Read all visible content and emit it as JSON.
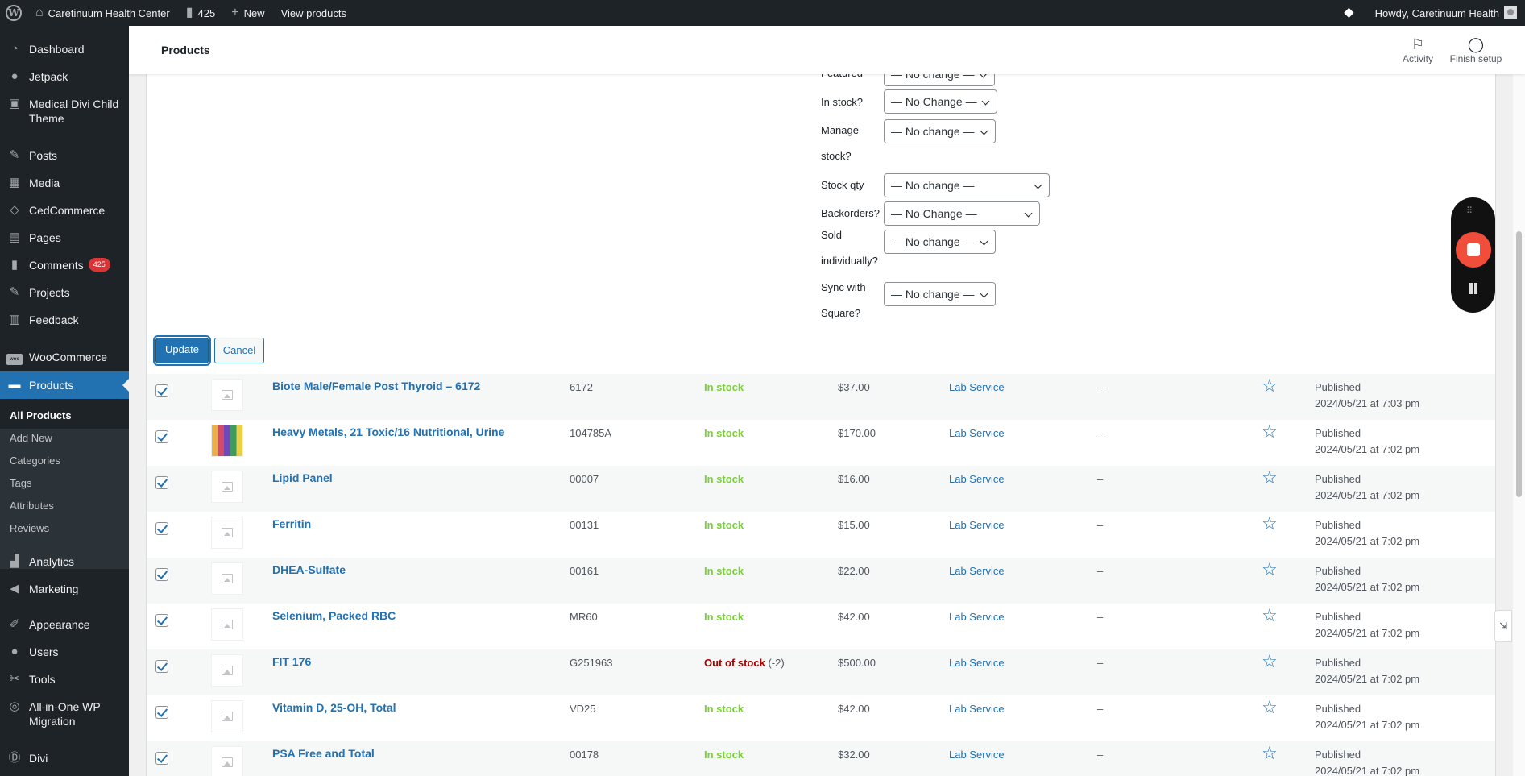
{
  "adminbar": {
    "site_name": "Caretinuum Health Center",
    "comments_count": "425",
    "new_label": "New",
    "view_products": "View products",
    "howdy": "Howdy, Caretinuum Health"
  },
  "sidebar": {
    "items": [
      {
        "label": "Dashboard"
      },
      {
        "label": "Jetpack"
      },
      {
        "label": "Medical Divi Child Theme"
      },
      {
        "label": "Posts"
      },
      {
        "label": "Media"
      },
      {
        "label": "CedCommerce"
      },
      {
        "label": "Pages"
      },
      {
        "label": "Comments",
        "badge": "425"
      },
      {
        "label": "Projects"
      },
      {
        "label": "Feedback"
      },
      {
        "label": "WooCommerce",
        "icon_text": "woo"
      },
      {
        "label": "Products"
      },
      {
        "label": "Analytics"
      },
      {
        "label": "Marketing"
      },
      {
        "label": "Appearance"
      },
      {
        "label": "Users"
      },
      {
        "label": "Tools"
      },
      {
        "label": "All-in-One WP Migration"
      },
      {
        "label": "Divi"
      }
    ],
    "submenu": [
      "All Products",
      "Add New",
      "Categories",
      "Tags",
      "Attributes",
      "Reviews"
    ]
  },
  "header": {
    "title": "Products",
    "activity": "Activity",
    "finish_setup": "Finish setup"
  },
  "bulk_edit": {
    "fields": [
      {
        "label": "Featured",
        "value": "— No change —"
      },
      {
        "label": "In stock?",
        "value": "— No Change —"
      },
      {
        "label": "Manage stock?",
        "value": "— No change —"
      },
      {
        "label": "Stock qty",
        "value": "— No change —"
      },
      {
        "label": "Backorders?",
        "value": "— No Change —"
      },
      {
        "label": "Sold individually?",
        "value": "— No change —"
      },
      {
        "label": "Sync with Square?",
        "value": "— No change —"
      }
    ],
    "update_label": "Update",
    "cancel_label": "Cancel"
  },
  "products": [
    {
      "name": "Biote Male/Female Post Thyroid – 6172",
      "sku": "6172",
      "stock": "In stock",
      "stock_extra": "",
      "price": "$37.00",
      "category": "Lab Service",
      "tags": "–",
      "status": "Published",
      "date": "2024/05/21 at 7:03 pm"
    },
    {
      "name": "Heavy Metals, 21 Toxic/16 Nutritional, Urine",
      "sku": "104785A",
      "stock": "In stock",
      "stock_extra": "",
      "price": "$170.00",
      "category": "Lab Service",
      "tags": "–",
      "status": "Published",
      "date": "2024/05/21 at 7:02 pm"
    },
    {
      "name": "Lipid Panel",
      "sku": "00007",
      "stock": "In stock",
      "stock_extra": "",
      "price": "$16.00",
      "category": "Lab Service",
      "tags": "–",
      "status": "Published",
      "date": "2024/05/21 at 7:02 pm"
    },
    {
      "name": "Ferritin",
      "sku": "00131",
      "stock": "In stock",
      "stock_extra": "",
      "price": "$15.00",
      "category": "Lab Service",
      "tags": "–",
      "status": "Published",
      "date": "2024/05/21 at 7:02 pm"
    },
    {
      "name": "DHEA-Sulfate",
      "sku": "00161",
      "stock": "In stock",
      "stock_extra": "",
      "price": "$22.00",
      "category": "Lab Service",
      "tags": "–",
      "status": "Published",
      "date": "2024/05/21 at 7:02 pm"
    },
    {
      "name": "Selenium, Packed RBC",
      "sku": "MR60",
      "stock": "In stock",
      "stock_extra": "",
      "price": "$42.00",
      "category": "Lab Service",
      "tags": "–",
      "status": "Published",
      "date": "2024/05/21 at 7:02 pm"
    },
    {
      "name": "FIT 176",
      "sku": "G251963",
      "stock": "Out of stock",
      "stock_extra": " (-2)",
      "price": "$500.00",
      "category": "Lab Service",
      "tags": "–",
      "status": "Published",
      "date": "2024/05/21 at 7:02 pm"
    },
    {
      "name": "Vitamin D, 25-OH, Total",
      "sku": "VD25",
      "stock": "In stock",
      "stock_extra": "",
      "price": "$42.00",
      "category": "Lab Service",
      "tags": "–",
      "status": "Published",
      "date": "2024/05/21 at 7:02 pm"
    },
    {
      "name": "PSA Free and Total",
      "sku": "00178",
      "stock": "In stock",
      "stock_extra": "",
      "price": "$32.00",
      "category": "Lab Service",
      "tags": "–",
      "status": "Published",
      "date": "2024/05/21 at 7:02 pm"
    }
  ],
  "side_tab_glyph": "⇲"
}
